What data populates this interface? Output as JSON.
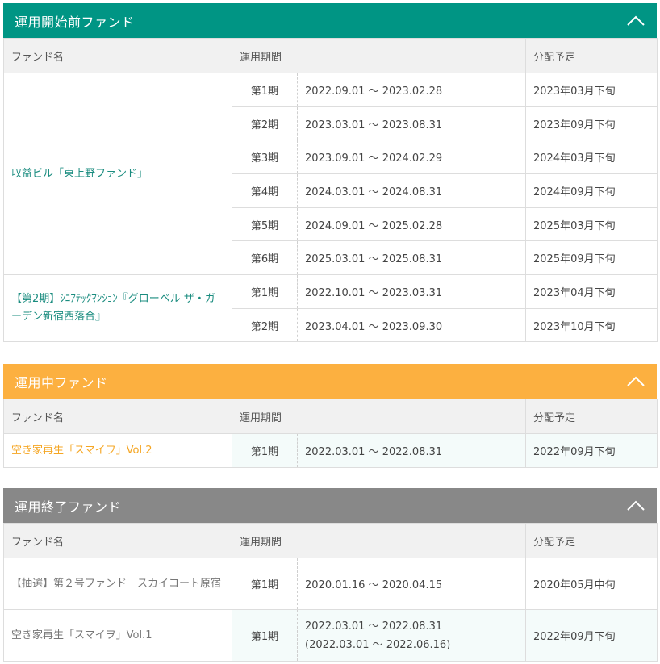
{
  "sections": [
    {
      "title": "運用開始前ファンド",
      "color": "#009584",
      "headers": {
        "fund": "ファンド名",
        "period": "運用期間",
        "dist": "分配予定"
      },
      "funds": [
        {
          "name": "収益ビル「東上野ファンド」",
          "rows": [
            {
              "ki": "第1期",
              "period": "2022.09.01 ～ 2023.02.28",
              "dist": "2023年03月下旬"
            },
            {
              "ki": "第2期",
              "period": "2023.03.01 ～ 2023.08.31",
              "dist": "2023年09月下旬"
            },
            {
              "ki": "第3期",
              "period": "2023.09.01 ～ 2024.02.29",
              "dist": "2024年03月下旬"
            },
            {
              "ki": "第4期",
              "period": "2024.03.01 ～ 2024.08.31",
              "dist": "2024年09月下旬"
            },
            {
              "ki": "第5期",
              "period": "2024.09.01 ～ 2025.02.28",
              "dist": "2025年03月下旬"
            },
            {
              "ki": "第6期",
              "period": "2025.03.01 ～ 2025.08.31",
              "dist": "2025年09月下旬"
            }
          ]
        },
        {
          "name": "【第2期】ｼﾆｱﾃｯｸﾏﾝｼｮﾝ『グローベル ザ・ガーデン新宿西落合』",
          "rows": [
            {
              "ki": "第1期",
              "period": "2022.10.01 ～ 2023.03.31",
              "dist": "2023年04月下旬"
            },
            {
              "ki": "第2期",
              "period": "2023.04.01 ～ 2023.09.30",
              "dist": "2023年10月下旬"
            }
          ]
        }
      ]
    },
    {
      "title": "運用中ファンド",
      "color": "#fcb040",
      "headers": {
        "fund": "ファンド名",
        "period": "運用期間",
        "dist": "分配予定"
      },
      "funds": [
        {
          "name": "空き家再生「スマイヲ」Vol.2",
          "rows": [
            {
              "ki": "第1期",
              "period": "2022.03.01 ～ 2022.08.31",
              "dist": "2022年09月下旬"
            }
          ]
        }
      ]
    },
    {
      "title": "運用終了ファンド",
      "color": "#888888",
      "headers": {
        "fund": "ファンド名",
        "period": "運用期間",
        "dist": "分配予定"
      },
      "funds": [
        {
          "name": "【抽選】第２号ファンド　スカイコート原宿",
          "rows": [
            {
              "ki": "第1期",
              "period": "2020.01.16 ～ 2020.04.15",
              "dist": "2020年05月中旬"
            }
          ]
        },
        {
          "name": "空き家再生「スマイヲ」Vol.1",
          "rows": [
            {
              "ki": "第1期",
              "period": "2022.03.01 ～ 2022.08.31",
              "period_sub": "(2022.03.01 ～ 2022.06.16)",
              "dist": "2022年09月下旬"
            }
          ]
        }
      ]
    }
  ],
  "icons": {
    "collapse": "chevron-up-icon"
  }
}
